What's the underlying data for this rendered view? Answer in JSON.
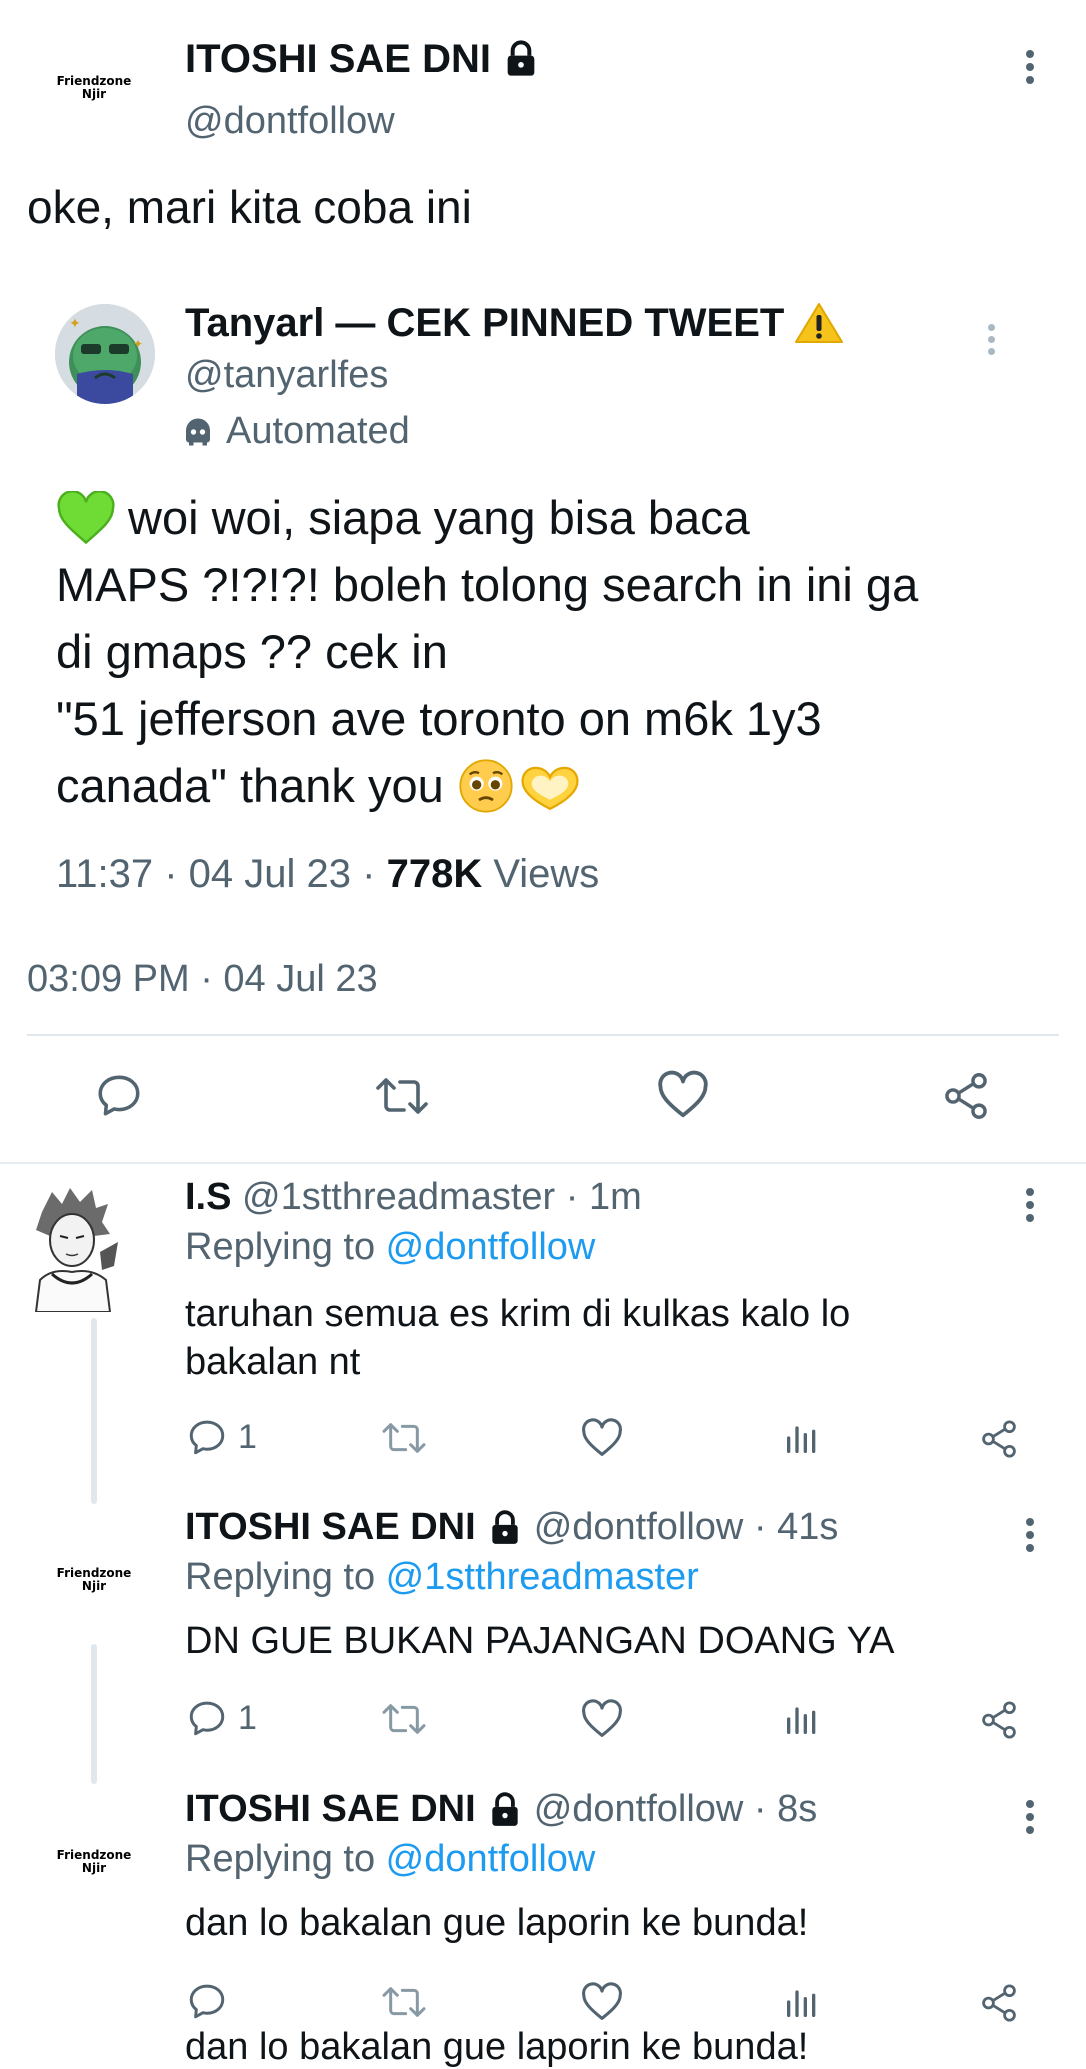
{
  "main_tweet": {
    "author_name": "ITOSHI SAE DNI",
    "author_handle": "@dontfollow",
    "avatar_text_line1": "Friendzone",
    "avatar_text_line2": "Njir",
    "text": "oke, mari kita coba ini",
    "timestamp": "03:09 PM · 04 Jul 23"
  },
  "quoted_tweet": {
    "author_name": "Tanyarl — CEK PINNED TWEET",
    "author_handle": "@tanyarlfes",
    "automated_label": "Automated",
    "text_line1": "woi woi, siapa yang bisa baca",
    "text_line2": "MAPS ?!?!?! boleh tolong search in ini ga",
    "text_line3": "di gmaps ?? cek in",
    "text_line4": "\"51 jefferson ave toronto on m6k 1y3",
    "text_line5": "canada\" thank you",
    "time": "11:37 · 04 Jul 23 · ",
    "views_count": "778K",
    "views_label": " Views"
  },
  "replies": [
    {
      "author_name": "I.S",
      "author_handle": "@1stthreadmaster · 1m",
      "replying_prefix": "Replying to ",
      "replying_to": "@dontfollow",
      "text_line1": "taruhan semua es krim di kulkas kalo lo",
      "text_line2": "bakalan nt",
      "reply_count": "1"
    },
    {
      "author_name": "ITOSHI SAE DNI",
      "author_handle": "@dontfollow · 41s",
      "replying_prefix": "Replying to ",
      "replying_to": "@1stthreadmaster",
      "text_line1": "DN GUE BUKAN PAJANGAN DOANG YA",
      "reply_count": "1",
      "avatar_text_line1": "Friendzone",
      "avatar_text_line2": "Njir"
    },
    {
      "author_name": "ITOSHI SAE DNI",
      "author_handle": "@dontfollow · 8s",
      "replying_prefix": "Replying to ",
      "replying_to": "@dontfollow",
      "text_line1": "dan lo bakalan gue laporin ke bunda!",
      "avatar_text_line1": "Friendzone",
      "avatar_text_line2": "Njir"
    }
  ],
  "bottom_peek_text": "dan lo bakalan gue laporin ke bunda!",
  "colors": {
    "link": "#1d9bf0",
    "muted": "#536471",
    "text": "#0f1419",
    "divider": "#e1e8ed"
  }
}
